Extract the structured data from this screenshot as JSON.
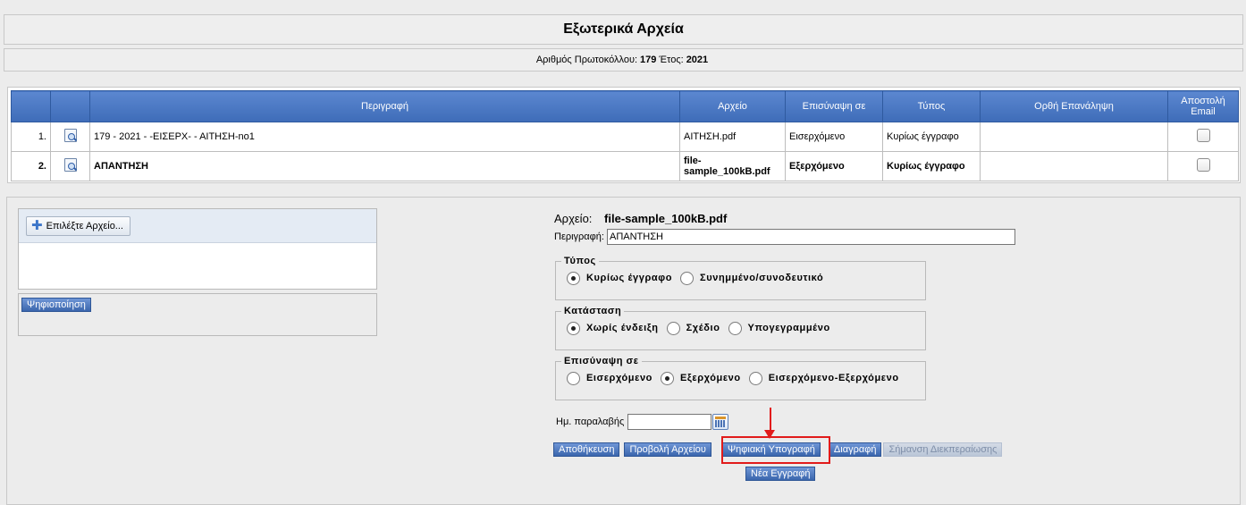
{
  "page": {
    "title": "Εξωτερικά Αρχεία"
  },
  "protocol": {
    "label": "Αριθμός Πρωτοκόλλου:",
    "number": "179",
    "year_label": "Έτος:",
    "year": "2021"
  },
  "grid": {
    "headers": [
      "",
      "",
      "Περιγραφή",
      "Αρχείο",
      "Επισύναψη σε",
      "Τύπος",
      "Ορθή Επανάληψη",
      "Αποστολή Email"
    ],
    "rows": [
      {
        "num": "1.",
        "icon": "document-view-icon",
        "description": "179 - 2021 - -ΕΙΣΕΡΧ- - ΑΙΤΗΣΗ-no1",
        "file": "ΑΙΤΗΣΗ.pdf",
        "attach": "Εισερχόμενο",
        "type": "Κυρίως έγγραφο",
        "repeat": "",
        "email_checked": false
      },
      {
        "num": "2.",
        "icon": "document-view-icon",
        "description": "ΑΠΑΝΤΗΣΗ",
        "file": "file-sample_100kB.pdf",
        "attach": "Εξερχόμενο",
        "type": "Κυρίως έγγραφο",
        "repeat": "",
        "email_checked": false
      }
    ]
  },
  "upload": {
    "select_label": "Επιλέξτε Αρχείο...",
    "select_icon": "plus-icon",
    "scan_label": "Ψηφιοποίηση"
  },
  "form": {
    "file_label": "Αρχείο:",
    "file_name": "file-sample_100kB.pdf",
    "desc_label": "Περιγραφή:",
    "desc_value": "ΑΠΑΝΤΗΣΗ",
    "type_group": {
      "legend": "Τύπος",
      "options": [
        "Κυρίως έγγραφο",
        "Συνημμένο/συνοδευτικό"
      ],
      "selected": 0
    },
    "status_group": {
      "legend": "Κατάσταση",
      "options": [
        "Χωρίς ένδειξη",
        "Σχέδιο",
        "Υπογεγραμμένο"
      ],
      "selected": 0
    },
    "attach_group": {
      "legend": "Επισύναψη σε",
      "options": [
        "Εισερχόμενο",
        "Εξερχόμενο",
        "Εισερχόμενο-Εξερχόμενο"
      ],
      "selected": 1
    },
    "date_label": "Ημ. παραλαβής",
    "date_value": "",
    "calendar_icon": "calendar-icon"
  },
  "actions": {
    "save": "Αποθήκευση",
    "view": "Προβολή Αρχείου",
    "sign": "Ψηφιακή Υπογραφή",
    "delete": "Διαγραφή",
    "mark_done": "Σήμανση Διεκπεραίωσης",
    "new_entry": "Νέα Εγγραφή"
  },
  "colors": {
    "header_blue": "#3e6cb8",
    "button_blue": "#3b66ad",
    "highlight_red": "#e11b1b"
  }
}
